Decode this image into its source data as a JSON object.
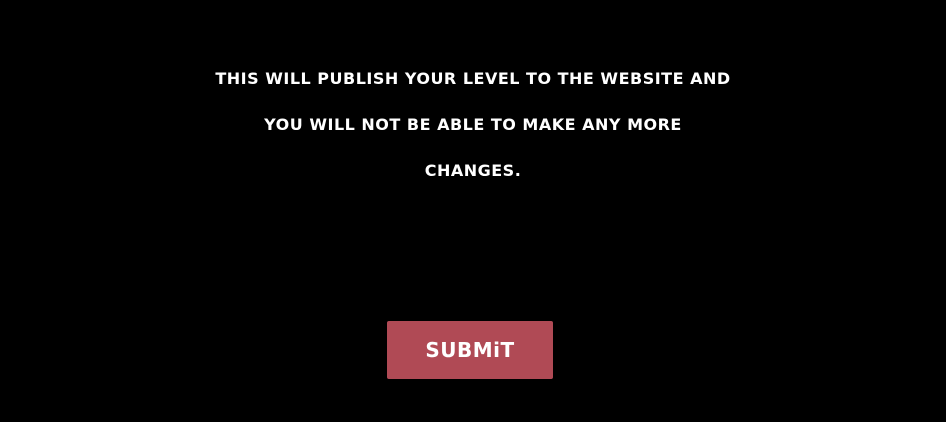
{
  "dialog": {
    "message_lines": [
      "THiS WiLL PUBLiSH YOUR LEVEL TO THE WEBSiTE AND",
      "YOU WiLL NOT BE ABLE TO MAKE ANY MORE",
      "CHANGES."
    ],
    "submit_label": "SUBMiT"
  },
  "colors": {
    "background": "#000000",
    "text": "#ffffff",
    "submit_button": "#b04a55"
  }
}
